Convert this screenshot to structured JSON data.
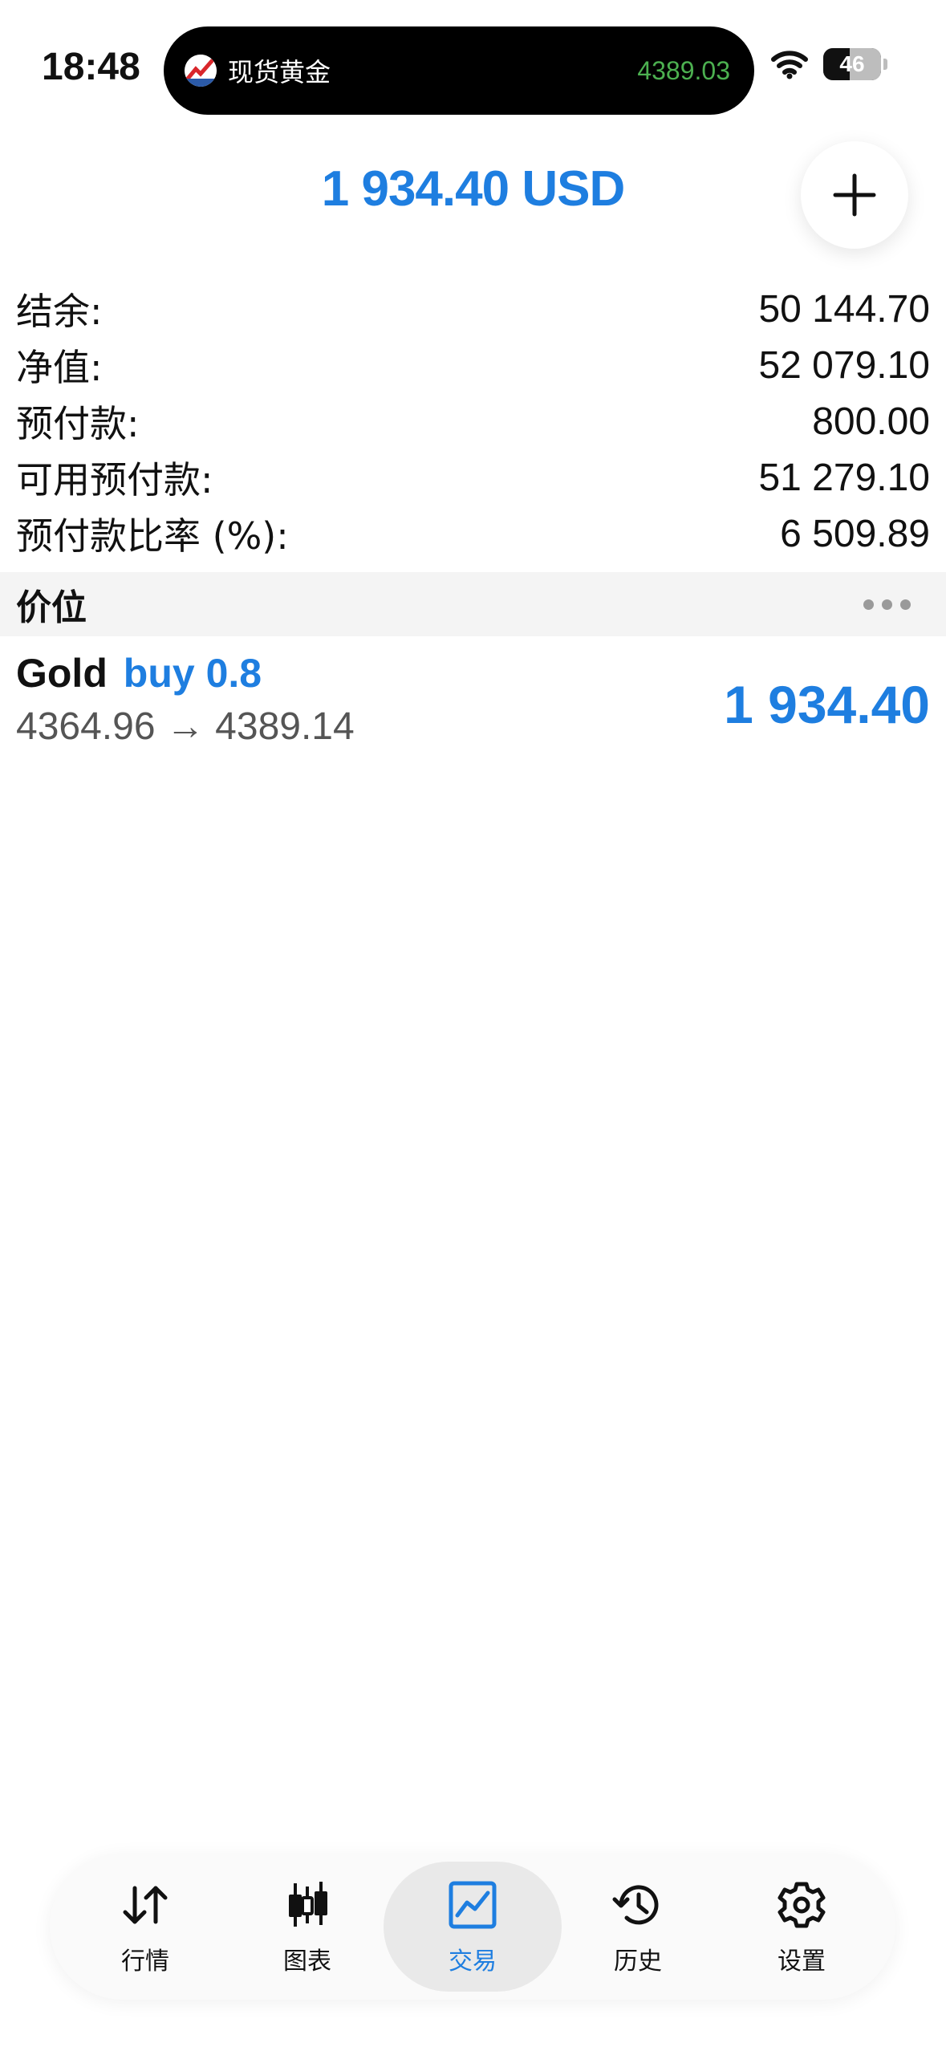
{
  "status_bar": {
    "time": "18:48",
    "island_title": "现货黄金",
    "island_price": "4389.03",
    "battery": "46"
  },
  "header": {
    "profit": "1 934.40 USD",
    "add_icon": "plus-icon"
  },
  "account": [
    {
      "label": "结余:",
      "value": "50 144.70"
    },
    {
      "label": "净值:",
      "value": "52 079.10"
    },
    {
      "label": "预付款:",
      "value": "800.00"
    },
    {
      "label": "可用预付款:",
      "value": "51 279.10"
    },
    {
      "label": "预付款比率 (%):",
      "value": "6 509.89"
    }
  ],
  "positions_section": {
    "title": "价位",
    "menu_icon": "more-icon"
  },
  "positions": [
    {
      "symbol": "Gold",
      "type": "buy 0.8",
      "prices": "4364.96 → 4389.14",
      "profit": "1 934.40"
    }
  ],
  "tabs": [
    {
      "label": "行情",
      "icon": "quotes-arrows-icon",
      "active": false
    },
    {
      "label": "图表",
      "icon": "candlestick-icon",
      "active": false
    },
    {
      "label": "交易",
      "icon": "trade-chart-icon",
      "active": true
    },
    {
      "label": "历史",
      "icon": "history-clock-icon",
      "active": false
    },
    {
      "label": "设置",
      "icon": "gear-icon",
      "active": false
    }
  ],
  "colors": {
    "accent": "#1e7ee0",
    "island_price": "#4cb050"
  }
}
